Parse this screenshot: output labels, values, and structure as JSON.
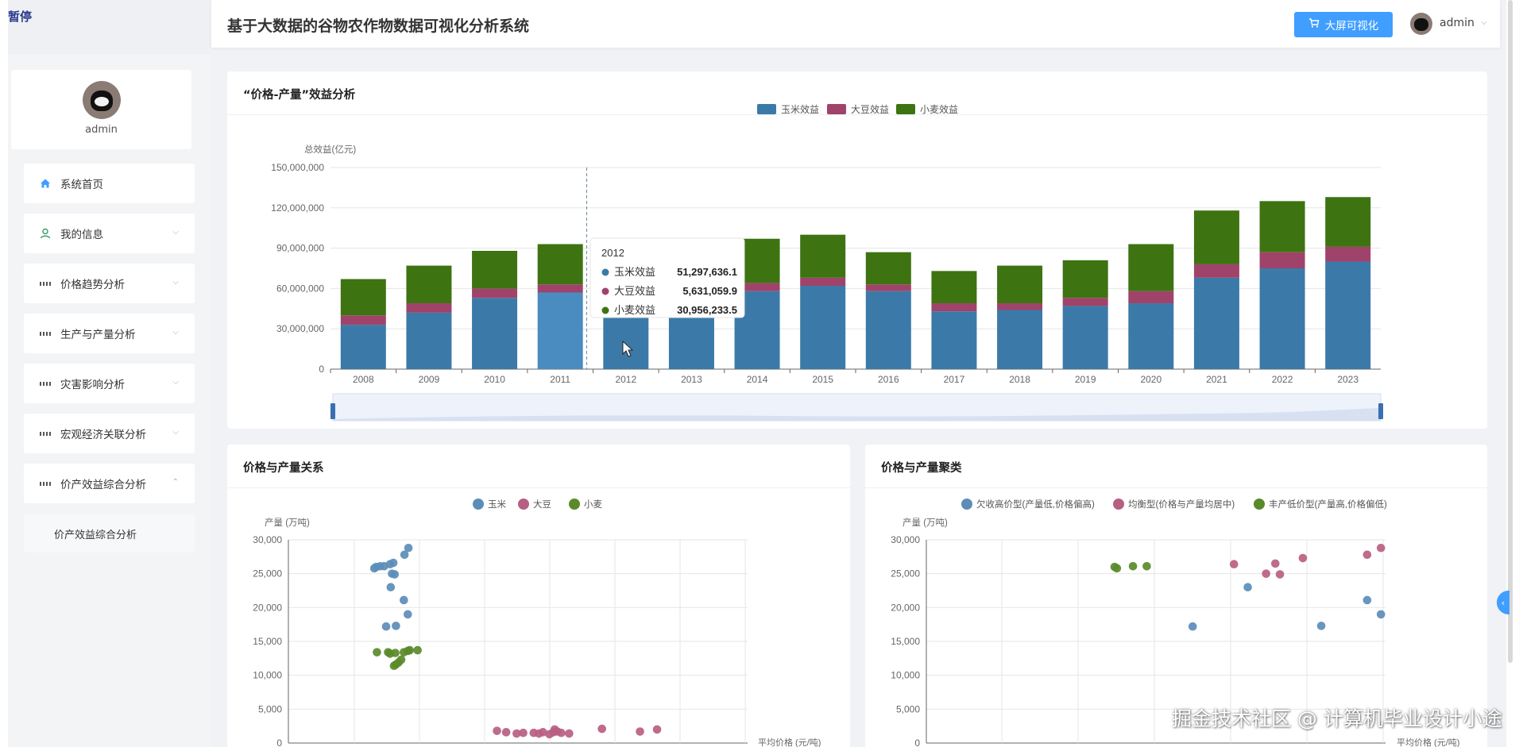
{
  "overlay": {
    "pause_label": "暂停",
    "watermark": "掘金技术社区 @ 计算机毕业设计小途"
  },
  "header": {
    "title": "基于大数据的谷物农作物数据可视化分析系统",
    "big_screen_label": "大屏可视化",
    "username": "admin"
  },
  "sidebar": {
    "profile_name": "admin",
    "items": [
      {
        "label": "系统首页",
        "icon": "home-icon",
        "expandable": false
      },
      {
        "label": "我的信息",
        "icon": "user-icon",
        "expandable": true
      },
      {
        "label": "价格趋势分析",
        "icon": "grid-icon",
        "expandable": true
      },
      {
        "label": "生产与产量分析",
        "icon": "grid-icon",
        "expandable": true
      },
      {
        "label": "灾害影响分析",
        "icon": "grid-icon",
        "expandable": true
      },
      {
        "label": "宏观经济关联分析",
        "icon": "grid-icon",
        "expandable": true
      },
      {
        "label": "价产效益综合分析",
        "icon": "grid-icon",
        "expandable": true,
        "expanded": true
      }
    ],
    "submenu_label": "价产效益综合分析"
  },
  "colors": {
    "corn": "#3b7aa8",
    "soy": "#a0436a",
    "wheat": "#3e7312",
    "corn_light": "#5b8db8",
    "soy_light": "#b85e82",
    "wheat_light": "#5a8a2a",
    "accent": "#409eff"
  },
  "cards": {
    "bar": {
      "title": "“价格-产量”效益分析"
    },
    "scatter": {
      "title": "价格与产量关系"
    },
    "cluster": {
      "title": "价格与产量聚类"
    }
  },
  "chart_data": [
    {
      "type": "bar",
      "stacked": true,
      "ylabel": "总效益(亿元)",
      "ylim": [
        0,
        150000000
      ],
      "yticks": [
        "150,000,000",
        "120,000,000",
        "90,000,000",
        "60,000,000",
        "30,000,000",
        "0"
      ],
      "categories": [
        "2008",
        "2009",
        "2010",
        "2011",
        "2012",
        "2013",
        "2014",
        "2015",
        "2016",
        "2017",
        "2018",
        "2019",
        "2020",
        "2021",
        "2022",
        "2023"
      ],
      "series": [
        {
          "name": "玉米效益",
          "values": [
            33000000,
            42000000,
            53000000,
            57000000,
            51297636,
            52000000,
            58000000,
            62000000,
            58000000,
            43000000,
            44000000,
            47000000,
            49000000,
            68000000,
            75000000,
            80000000
          ]
        },
        {
          "name": "大豆效益",
          "values": [
            7000000,
            7000000,
            7000000,
            6000000,
            5631060,
            6000000,
            6000000,
            6000000,
            5000000,
            6000000,
            5000000,
            6000000,
            9000000,
            10000000,
            12000000,
            11000000
          ]
        },
        {
          "name": "小麦效益",
          "values": [
            27000000,
            28000000,
            28000000,
            30000000,
            30956234,
            32000000,
            33000000,
            32000000,
            24000000,
            24000000,
            28000000,
            28000000,
            35000000,
            40000000,
            38000000,
            37000000
          ]
        }
      ],
      "legend_position": "top-center",
      "tooltip": {
        "title": "2012",
        "rows": [
          {
            "label": "玉米效益",
            "value": "51,297,636.1"
          },
          {
            "label": "大豆效益",
            "value": "5,631,059.9"
          },
          {
            "label": "小麦效益",
            "value": "30,956,233.5"
          }
        ]
      }
    },
    {
      "type": "scatter",
      "ylabel": "产量 (万吨)",
      "xlabel": "平均价格 (元/吨)",
      "ylim": [
        0,
        30000
      ],
      "yticks": [
        "30,000",
        "25,000",
        "20,000",
        "15,000",
        "10,000",
        "5,000",
        "0"
      ],
      "series": [
        {
          "name": "玉米",
          "points": [
            [
              1755,
              25800
            ],
            [
              1770,
              26000
            ],
            [
              1800,
              26100
            ],
            [
              1830,
              26100
            ],
            [
              1875,
              26400
            ],
            [
              1900,
              26600
            ],
            [
              1890,
              25000
            ],
            [
              1910,
              24900
            ],
            [
              1880,
              23000
            ],
            [
              1985,
              27800
            ],
            [
              2015,
              28800
            ],
            [
              1980,
              21100
            ],
            [
              2010,
              19000
            ],
            [
              1920,
              17300
            ],
            [
              1845,
              17200
            ]
          ]
        },
        {
          "name": "大豆",
          "points": [
            [
              2690,
              1800
            ],
            [
              2760,
              1600
            ],
            [
              2840,
              1400
            ],
            [
              2890,
              1500
            ],
            [
              2970,
              1500
            ],
            [
              3010,
              1400
            ],
            [
              3040,
              1600
            ],
            [
              3090,
              1300
            ],
            [
              3120,
              1600
            ],
            [
              3130,
              2000
            ],
            [
              3150,
              1700
            ],
            [
              3180,
              1500
            ],
            [
              3240,
              1400
            ],
            [
              3490,
              2100
            ],
            [
              3780,
              1700
            ],
            [
              3910,
              2000
            ]
          ]
        },
        {
          "name": "小麦",
          "points": [
            [
              1775,
              13400
            ],
            [
              1860,
              13400
            ],
            [
              1875,
              13200
            ],
            [
              1905,
              11400
            ],
            [
              1920,
              11600
            ],
            [
              1940,
              11900
            ],
            [
              1960,
              12300
            ],
            [
              1980,
              13400
            ],
            [
              2010,
              13600
            ],
            [
              2025,
              13700
            ],
            [
              2085,
              13700
            ],
            [
              1915,
              13300
            ]
          ]
        }
      ]
    },
    {
      "type": "scatter",
      "ylabel": "产量 (万吨)",
      "xlabel": "平均价格 (元/吨)",
      "ylim": [
        0,
        30000
      ],
      "yticks": [
        "30,000",
        "25,000",
        "20,000",
        "15,000",
        "10,000",
        "5,000",
        "0"
      ],
      "series": [
        {
          "name": "欠收高价型(产量低,价格偏高)",
          "points": [
            [
              0.58,
              17200
            ],
            [
              0.7,
              23000
            ],
            [
              0.86,
              17300
            ],
            [
              0.96,
              21100
            ],
            [
              0.99,
              19000
            ]
          ]
        },
        {
          "name": "均衡型(价格与产量均居中)",
          "points": [
            [
              0.67,
              26400
            ],
            [
              0.74,
              25000
            ],
            [
              0.76,
              26500
            ],
            [
              0.77,
              24900
            ],
            [
              0.82,
              27300
            ],
            [
              0.96,
              27800
            ],
            [
              0.99,
              28800
            ]
          ]
        },
        {
          "name": "丰产低价型(产量高,价格偏低)",
          "points": [
            [
              0.41,
              26000
            ],
            [
              0.415,
              25800
            ],
            [
              0.45,
              26100
            ],
            [
              0.48,
              26100
            ]
          ]
        }
      ]
    }
  ]
}
